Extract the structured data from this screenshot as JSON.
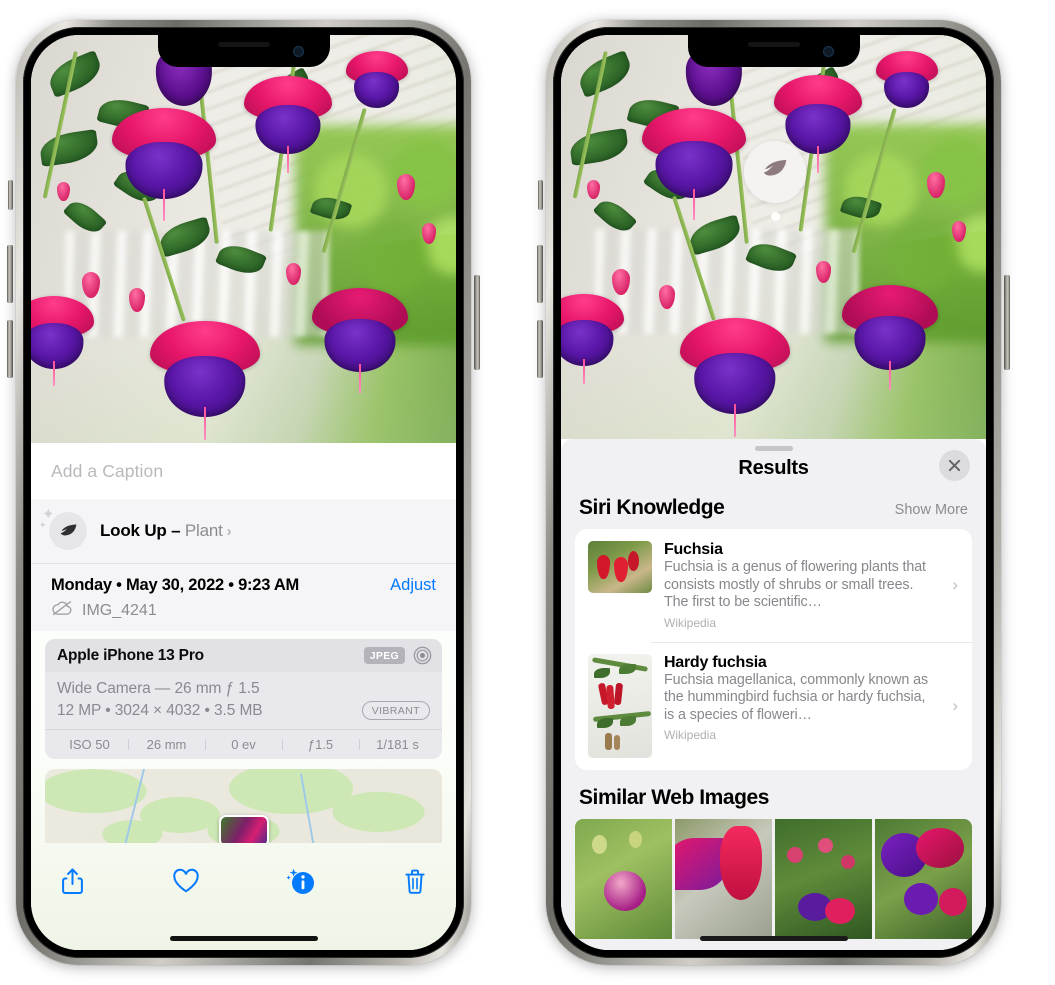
{
  "left_phone": {
    "caption": {
      "placeholder": "Add a Caption",
      "value": ""
    },
    "lookup": {
      "icon": "leaf-icon",
      "label": "Look Up – ",
      "subject": "Plant",
      "chevron": "›"
    },
    "details": {
      "datetime": "Monday • May 30, 2022 • 9:23 AM",
      "adjust_label": "Adjust",
      "cloud_icon": "cloud-slash-icon",
      "filename": "IMG_4241"
    },
    "exif": {
      "device": "Apple iPhone 13 Pro",
      "format_badge": "JPEG",
      "lens_icon": "lens-icon",
      "lens_line": "Wide Camera — 26 mm ƒ 1.5",
      "size_line": "12 MP • 3024 × 4032 • 3.5 MB",
      "style_badge": "VIBRANT",
      "stats": [
        "ISO 50",
        "26 mm",
        "0 ev",
        "ƒ1.5",
        "1/181 s"
      ]
    },
    "map": {
      "pin_label": "photo-pin"
    },
    "toolbar": [
      {
        "name": "share-button",
        "icon": "share-icon"
      },
      {
        "name": "favorite-button",
        "icon": "heart-icon"
      },
      {
        "name": "info-button",
        "icon": "info-sparkle-icon"
      },
      {
        "name": "delete-button",
        "icon": "trash-icon"
      }
    ]
  },
  "right_phone": {
    "visual_lookup_badge": {
      "icon": "leaf-icon"
    },
    "sheet": {
      "title": "Results",
      "close_icon": "close-icon"
    },
    "siri_knowledge": {
      "heading": "Siri Knowledge",
      "show_more": "Show More",
      "results": [
        {
          "title": "Fuchsia",
          "description": "Fuchsia is a genus of flowering plants that consists mostly of shrubs or small trees. The first to be scientific…",
          "source": "Wikipedia",
          "thumb": "fuchsia-red-flowers-thumb"
        },
        {
          "title": "Hardy fuchsia",
          "description": "Fuchsia magellanica, commonly known as the hummingbird fuchsia or hardy fuchsia, is a species of floweri…",
          "source": "Wikipedia",
          "thumb": "hardy-fuchsia-branch-thumb"
        }
      ]
    },
    "similar_web_images": {
      "heading": "Similar Web Images",
      "thumbs": [
        "pink-white-fuchsia-thumb",
        "red-fuchsia-closeup-thumb",
        "fuchsia-bush-thumb",
        "purple-fuchsia-thumb"
      ]
    }
  },
  "colors": {
    "accent_blue": "#047aff",
    "sheet_bg": "#f1f1f4",
    "card_bg": "#ffffff",
    "secondary_text": "#8b8b91"
  }
}
